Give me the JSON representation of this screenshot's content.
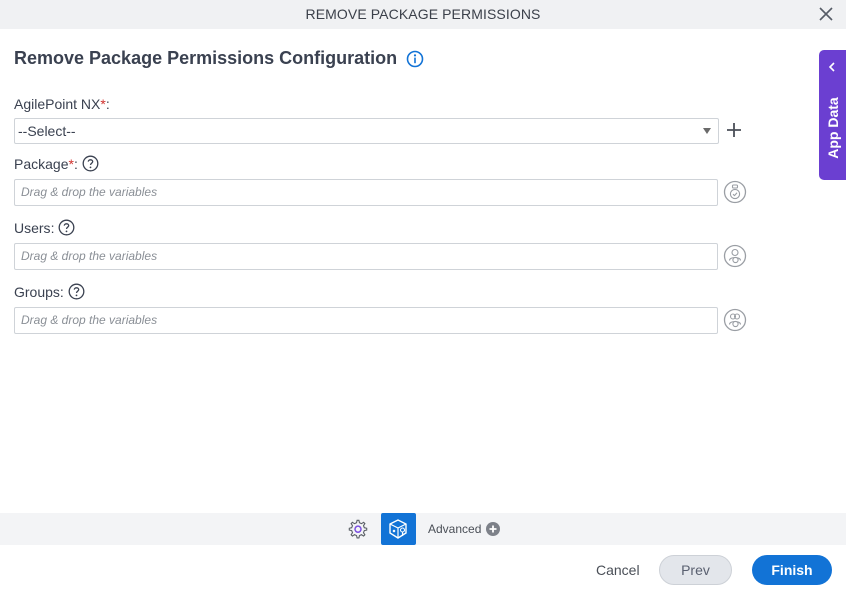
{
  "window": {
    "title": "REMOVE PACKAGE PERMISSIONS",
    "close_icon": "close-icon"
  },
  "form": {
    "heading": "Remove Package Permissions Configuration",
    "fields": [
      {
        "label": "AgilePoint NX",
        "required": true,
        "type": "select",
        "value": "--Select--",
        "has_help": false
      },
      {
        "label": "Package",
        "required": true,
        "type": "variable-input",
        "placeholder": "Drag & drop the variables",
        "has_help": true
      },
      {
        "label": "Users",
        "required": false,
        "type": "variable-input",
        "placeholder": "Drag & drop the variables",
        "has_help": true
      },
      {
        "label": "Groups",
        "required": false,
        "type": "variable-input",
        "placeholder": "Drag & drop the variables",
        "has_help": true
      }
    ],
    "required_mark": "*",
    "colon": ":"
  },
  "side_panel": {
    "label": "App Data"
  },
  "bottom_bar": {
    "advanced_label": "Advanced"
  },
  "footer": {
    "cancel_label": "Cancel",
    "prev_label": "Prev",
    "finish_label": "Finish"
  },
  "colors": {
    "accent": "#1273d6",
    "app_data": "#6b3fd1",
    "required": "#d0312d"
  }
}
